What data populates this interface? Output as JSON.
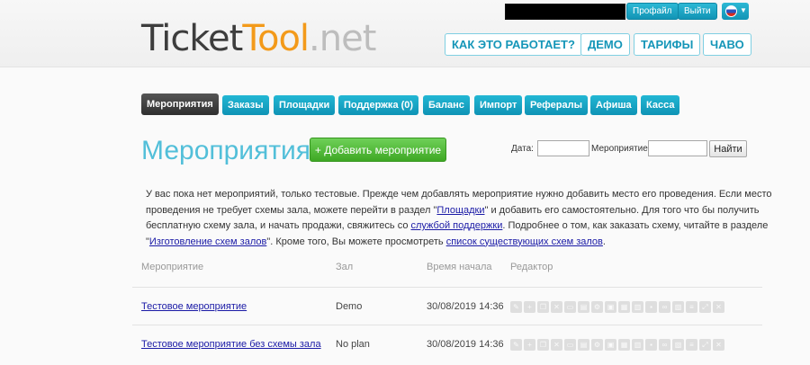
{
  "header": {
    "profile_label": "Профайл",
    "logout_label": "Выйти",
    "language_icon": "flag-ru-icon",
    "logo": {
      "part1": "Ticket",
      "part2": "Tool",
      "part3": ".net"
    },
    "nav": [
      {
        "label": "КАК ЭТО РАБОТАЕТ?"
      },
      {
        "label": "ДЕМО"
      },
      {
        "label": "ТАРИФЫ"
      },
      {
        "label": "ЧАВО"
      }
    ]
  },
  "tabs": [
    {
      "label": "Мероприятия",
      "active": true
    },
    {
      "label": "Заказы"
    },
    {
      "label": "Площадки"
    },
    {
      "label": "Поддержка (0)"
    },
    {
      "label": "Баланс"
    },
    {
      "label": "Импорт"
    },
    {
      "label": "Рефералы"
    },
    {
      "label": "Афиша"
    },
    {
      "label": "Касса"
    }
  ],
  "page": {
    "title": "Мероприятия",
    "add_button": "+ Добавить мероприятие"
  },
  "filter": {
    "date_label": "Дата:",
    "date_value": "",
    "event_label": "Мероприятие:",
    "event_value": "",
    "find_button": "Найти"
  },
  "info": {
    "t1": "У вас пока нет мероприятий, только тестовые. Прежде чем добавлять мероприятие нужно добавить место его проведения. Если место проведения не требует схемы зала, можете перейти в раздел \"",
    "link_venues": "Площадки",
    "t2": "\" и добавить его самостоятельно. Для того что бы получить бесплатную схему зала, и начать продажи, свяжитесь со ",
    "link_support": "службой поддержки",
    "t3": ". Подробнее о том, как заказать схему, читайте в разделе \"",
    "link_schemes": "Изготовление схем залов",
    "t4": "\". Кроме того, Вы можете просмотреть ",
    "link_list": "список существующих схем залов",
    "t5": "."
  },
  "table": {
    "headers": [
      "Мероприятие",
      "Зал",
      "Время начала",
      "Редактор"
    ],
    "rows": [
      {
        "event": "Тестовое мероприятие",
        "hall": "Demo",
        "start": "30/08/2019 14:36"
      },
      {
        "event": "Тестовое мероприятие без схемы зала",
        "hall": "No plan",
        "start": "30/08/2019 14:36"
      }
    ],
    "tool_icons": [
      "edit-icon",
      "add-icon",
      "copy-icon",
      "delete-icon",
      "folder-icon",
      "ticket-icon",
      "settings-icon",
      "image-icon",
      "print-icon",
      "chart-icon",
      "lock-icon",
      "link-icon",
      "calendar-icon",
      "list-icon",
      "expand-icon",
      "close-icon"
    ]
  },
  "colors": {
    "accent": "#1596b8",
    "tab_active": "#3a3a3a",
    "add_button": "#4cbb30",
    "title": "#52bfd9",
    "link": "#1a1aa6"
  }
}
